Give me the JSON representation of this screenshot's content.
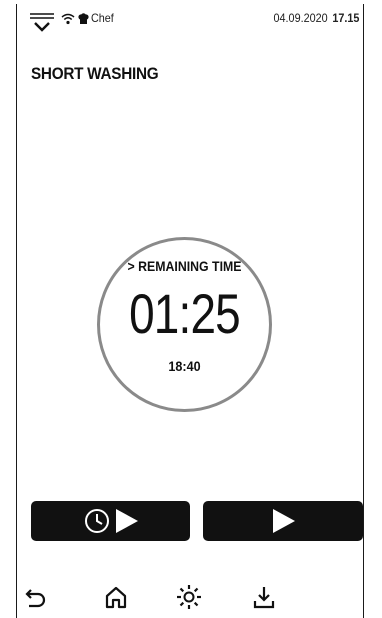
{
  "status_bar": {
    "profile": "Chef",
    "date": "04.09.2020",
    "time": "17.15"
  },
  "page": {
    "title": "SHORT WASHING"
  },
  "timer": {
    "label": "> REMAINING TIME",
    "remaining": "01:25",
    "end_time": "18:40"
  },
  "actions": {
    "delayed_start_icons": [
      "clock-icon",
      "play-icon"
    ],
    "start_icon": "play-icon"
  },
  "nav": {
    "items": [
      "back-icon",
      "home-icon",
      "light-icon",
      "download-icon"
    ]
  },
  "colors": {
    "button_bg": "#111111",
    "ring": "#8a8a8a",
    "text": "#111111"
  }
}
